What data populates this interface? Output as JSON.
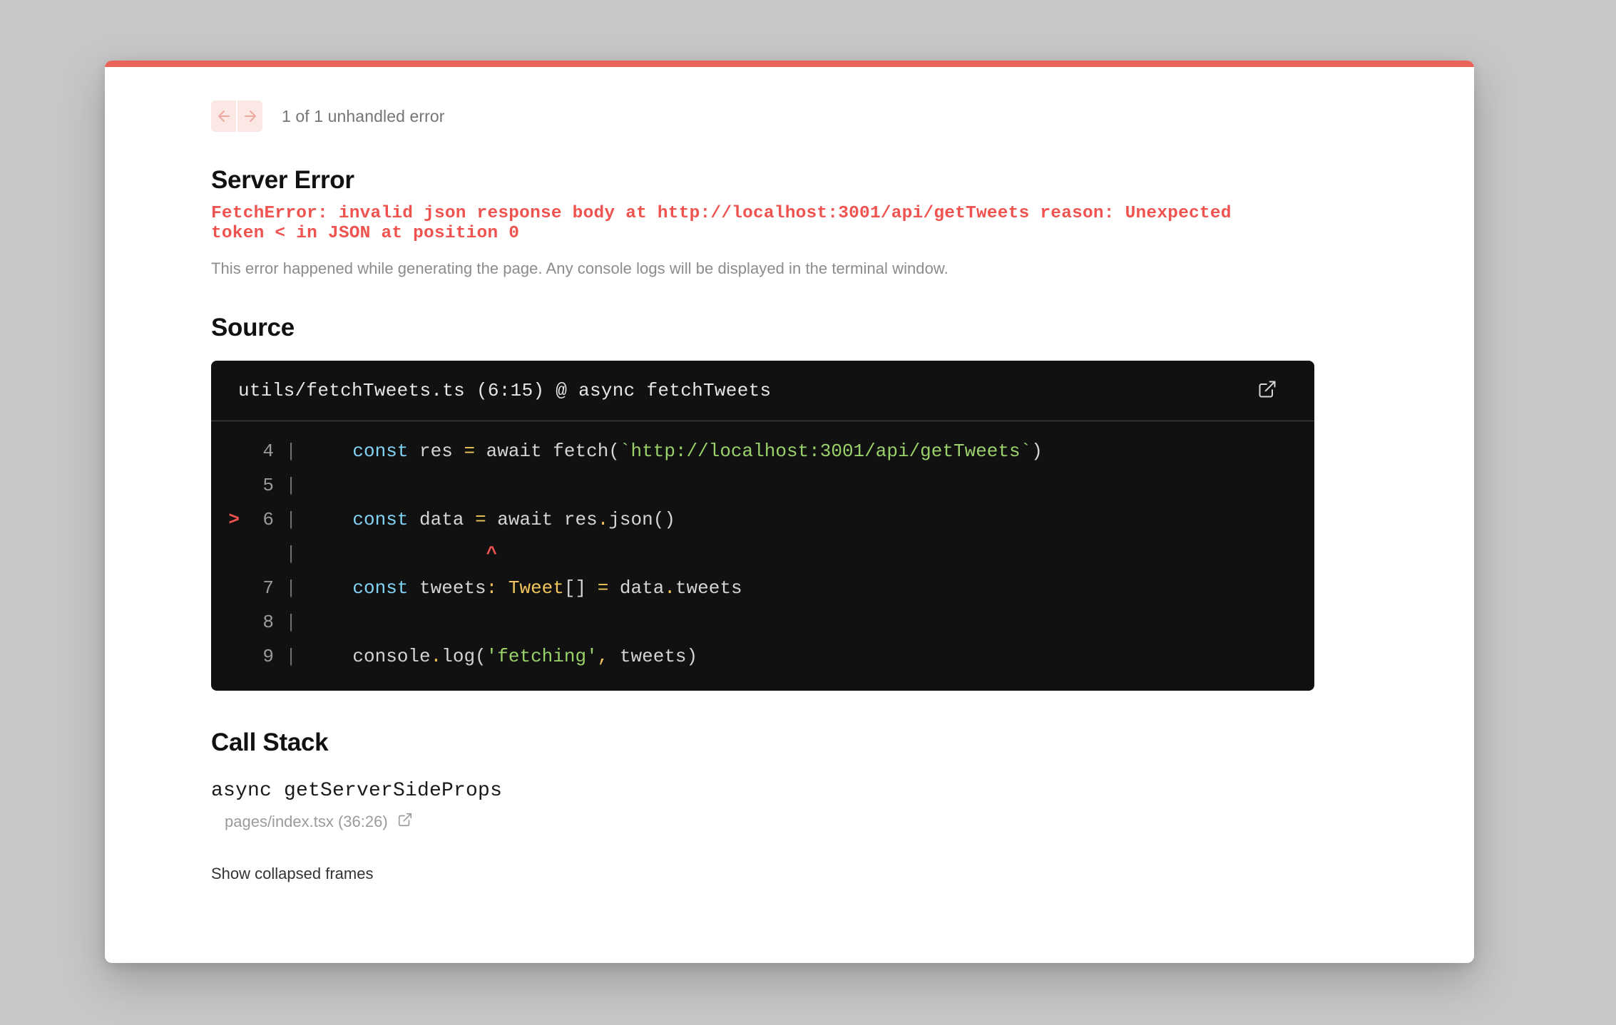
{
  "colors": {
    "accent_bar": "#e8645a",
    "error_text": "#ef5350",
    "nav_button_bg": "#fbe7e4",
    "code_bg": "#111111",
    "page_bg": "#c7c7c7",
    "string_token": "#9ad16a",
    "keyword_token": "#84d3f7",
    "operator_token": "#f2c55c"
  },
  "header": {
    "prev_icon": "arrow-left-icon",
    "next_icon": "arrow-right-icon",
    "counter": "1 of 1 unhandled error"
  },
  "error": {
    "title": "Server Error",
    "message": "FetchError: invalid json response body at http://localhost:3001/api/getTweets reason: Unexpected token < in JSON at position 0",
    "note": "This error happened while generating the page. Any console logs will be displayed in the terminal window."
  },
  "source": {
    "title": "Source",
    "file_label": "utils/fetchTweets.ts (6:15) @ async fetchTweets",
    "open_icon": "external-link-icon",
    "lines": [
      {
        "number": "4",
        "marker": "",
        "pipe": "|",
        "tokens": [
          {
            "text": "    ",
            "type": "plain"
          },
          {
            "text": "const",
            "type": "kw"
          },
          {
            "text": " res ",
            "type": "plain"
          },
          {
            "text": "=",
            "type": "op"
          },
          {
            "text": " await fetch(",
            "type": "plain"
          },
          {
            "text": "`http://localhost:3001/api/getTweets`",
            "type": "str"
          },
          {
            "text": ")",
            "type": "plain"
          }
        ]
      },
      {
        "number": "5",
        "marker": "",
        "pipe": "|",
        "tokens": []
      },
      {
        "number": "6",
        "marker": ">",
        "pipe": "|",
        "tokens": [
          {
            "text": "    ",
            "type": "plain"
          },
          {
            "text": "const",
            "type": "kw"
          },
          {
            "text": " data ",
            "type": "plain"
          },
          {
            "text": "=",
            "type": "op"
          },
          {
            "text": " await res",
            "type": "plain"
          },
          {
            "text": ".",
            "type": "op"
          },
          {
            "text": "json()",
            "type": "plain"
          }
        ]
      },
      {
        "number": "",
        "marker": "",
        "pipe": "|",
        "tokens": [
          {
            "text": "                ",
            "type": "plain"
          },
          {
            "text": "^",
            "type": "caret"
          }
        ]
      },
      {
        "number": "7",
        "marker": "",
        "pipe": "|",
        "tokens": [
          {
            "text": "    ",
            "type": "plain"
          },
          {
            "text": "const",
            "type": "kw"
          },
          {
            "text": " tweets",
            "type": "plain"
          },
          {
            "text": ":",
            "type": "op"
          },
          {
            "text": " ",
            "type": "plain"
          },
          {
            "text": "Tweet",
            "type": "type"
          },
          {
            "text": "[] ",
            "type": "plain"
          },
          {
            "text": "=",
            "type": "op"
          },
          {
            "text": " data",
            "type": "plain"
          },
          {
            "text": ".",
            "type": "op"
          },
          {
            "text": "tweets",
            "type": "plain"
          }
        ]
      },
      {
        "number": "8",
        "marker": "",
        "pipe": "|",
        "tokens": []
      },
      {
        "number": "9",
        "marker": "",
        "pipe": "|",
        "tokens": [
          {
            "text": "    ",
            "type": "plain"
          },
          {
            "text": "console",
            "type": "plain"
          },
          {
            "text": ".",
            "type": "op"
          },
          {
            "text": "log(",
            "type": "plain"
          },
          {
            "text": "'fetching'",
            "type": "str"
          },
          {
            "text": ",",
            "type": "op"
          },
          {
            "text": " tweets)",
            "type": "plain"
          }
        ]
      }
    ]
  },
  "call_stack": {
    "title": "Call Stack",
    "frames": [
      {
        "function": "async getServerSideProps",
        "location": "pages/index.tsx (36:26)",
        "open_icon": "external-link-icon"
      }
    ],
    "show_collapsed_label": "Show collapsed frames"
  }
}
